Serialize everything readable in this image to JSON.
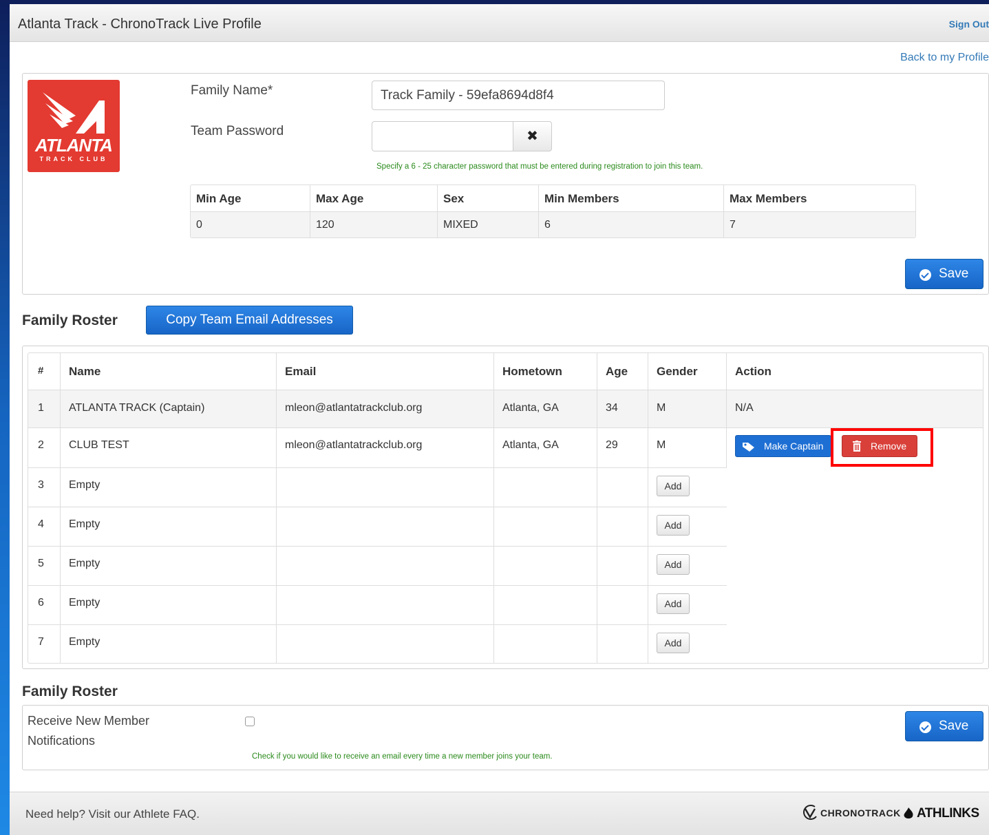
{
  "header": {
    "title": "Atlanta Track - ChronoTrack Live Profile",
    "sign_out": "Sign Out",
    "back_link": "Back to my Profile"
  },
  "logo": {
    "word": "ATLANTA",
    "sub": "TRACK CLUB"
  },
  "team_form": {
    "family_name_label": "Family Name*",
    "family_name_value": "Track Family - 59efa8694d8f4",
    "password_label": "Team Password",
    "password_value": "",
    "clear_icon": "✖",
    "password_hint": "Specify a 6 - 25 character password that must be entered during registration to join this team.",
    "constraints_headers": [
      "Min Age",
      "Max Age",
      "Sex",
      "Min Members",
      "Max Members"
    ],
    "constraints_values": [
      "0",
      "120",
      "MIXED",
      "6",
      "7"
    ],
    "save_label": "Save"
  },
  "roster": {
    "title": "Family Roster",
    "copy_button": "Copy Team Email Addresses",
    "headers": [
      "#",
      "Name",
      "Email",
      "Hometown",
      "Age",
      "Gender",
      "Action"
    ],
    "rows": [
      {
        "num": "1",
        "name": "ATLANTA TRACK (Captain)",
        "email": "mleon@atlantatrackclub.org",
        "hometown": "Atlanta, GA",
        "age": "34",
        "gender": "M",
        "action": "N/A"
      },
      {
        "num": "2",
        "name": "CLUB TEST",
        "email": "mleon@atlantatrackclub.org",
        "hometown": "Atlanta, GA",
        "age": "29",
        "gender": "M",
        "make_captain": "Make Captain",
        "remove": "Remove"
      },
      {
        "num": "3",
        "name": "Empty",
        "add": "Add"
      },
      {
        "num": "4",
        "name": "Empty",
        "add": "Add"
      },
      {
        "num": "5",
        "name": "Empty",
        "add": "Add"
      },
      {
        "num": "6",
        "name": "Empty",
        "add": "Add"
      },
      {
        "num": "7",
        "name": "Empty",
        "add": "Add"
      }
    ]
  },
  "notifications": {
    "title": "Family Roster",
    "label_line1": "Receive New Member",
    "label_line2": "Notifications",
    "checked": false,
    "hint": "Check if you would like to receive an email every time a new member joins your team.",
    "save_label": "Save"
  },
  "footer": {
    "help": "Need help? Visit our Athlete FAQ.",
    "brand1": "CHRONOTRACK",
    "brand2": "ATHLINKS"
  },
  "colors": {
    "primary": "#1e6fd4",
    "danger": "#d9403a",
    "hint": "#2a8a1b",
    "highlight": "#ff0000",
    "logo": "#e33a31"
  }
}
